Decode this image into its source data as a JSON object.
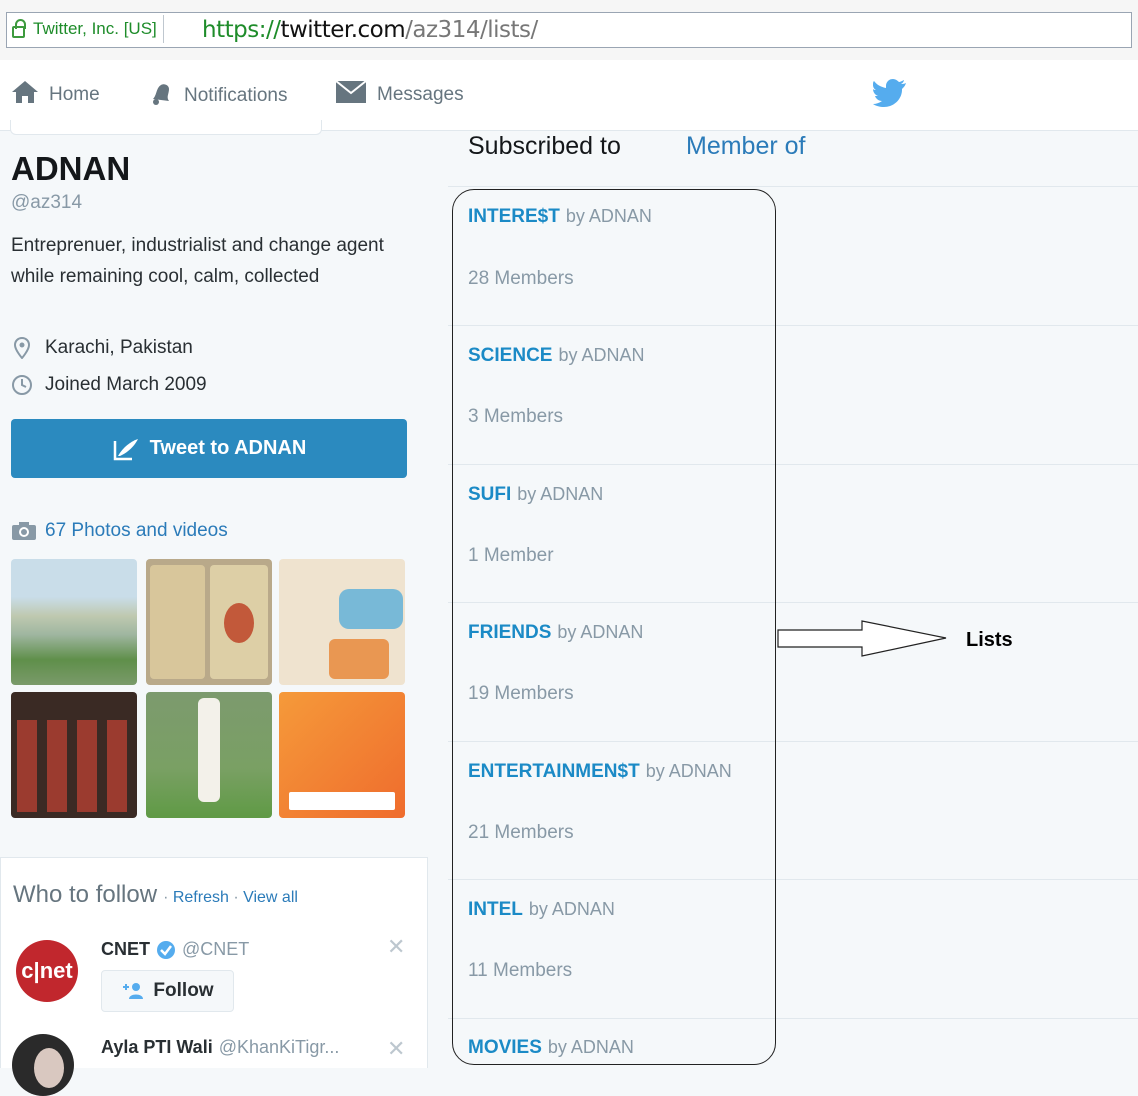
{
  "browser": {
    "security_label": "Twitter, Inc. [US]",
    "url_scheme": "https://",
    "url_domain": "twitter.com",
    "url_path": "/az314/lists/"
  },
  "nav": {
    "home": "Home",
    "notifications": "Notifications",
    "messages": "Messages",
    "brand_color": "#55acee"
  },
  "profile": {
    "name": "ADNAN",
    "handle": "@az314",
    "bio": "Entreprenuer, industrialist and change agent while remaining cool, calm, collected",
    "location": "Karachi, Pakistan",
    "joined": "Joined March 2009",
    "tweet_button": "Tweet to ADNAN",
    "photos_link": "67 Photos and videos"
  },
  "who_to_follow": {
    "title": "Who to follow",
    "separator1": " · ",
    "refresh": "Refresh",
    "separator2": " · ",
    "view_all": "View all",
    "accounts": [
      {
        "name": "CNET",
        "handle": "@CNET",
        "avatar_text": "c|net",
        "verified": true
      },
      {
        "name": "Ayla PTI Wali",
        "handle": "@KhanKiTigr...",
        "verified": false
      }
    ],
    "follow_label": "Follow"
  },
  "tabs": {
    "subscribed": "Subscribed to",
    "member_of": "Member of"
  },
  "lists": [
    {
      "name": "INTERE$T",
      "by": "by ADNAN",
      "members": "28 Members"
    },
    {
      "name": "SCIENCE",
      "by": "by ADNAN",
      "members": "3 Members"
    },
    {
      "name": "SUFI",
      "by": "by ADNAN",
      "members": "1 Member"
    },
    {
      "name": "FRIENDS",
      "by": "by ADNAN",
      "members": "19 Members"
    },
    {
      "name": "ENTERTAINMEN$T",
      "by": "by ADNAN",
      "members": "21 Members"
    },
    {
      "name": "INTEL",
      "by": "by ADNAN",
      "members": "11 Members"
    },
    {
      "name": "MOVIES",
      "by": "by ADNAN"
    }
  ],
  "annotation": {
    "label": "Lists"
  }
}
